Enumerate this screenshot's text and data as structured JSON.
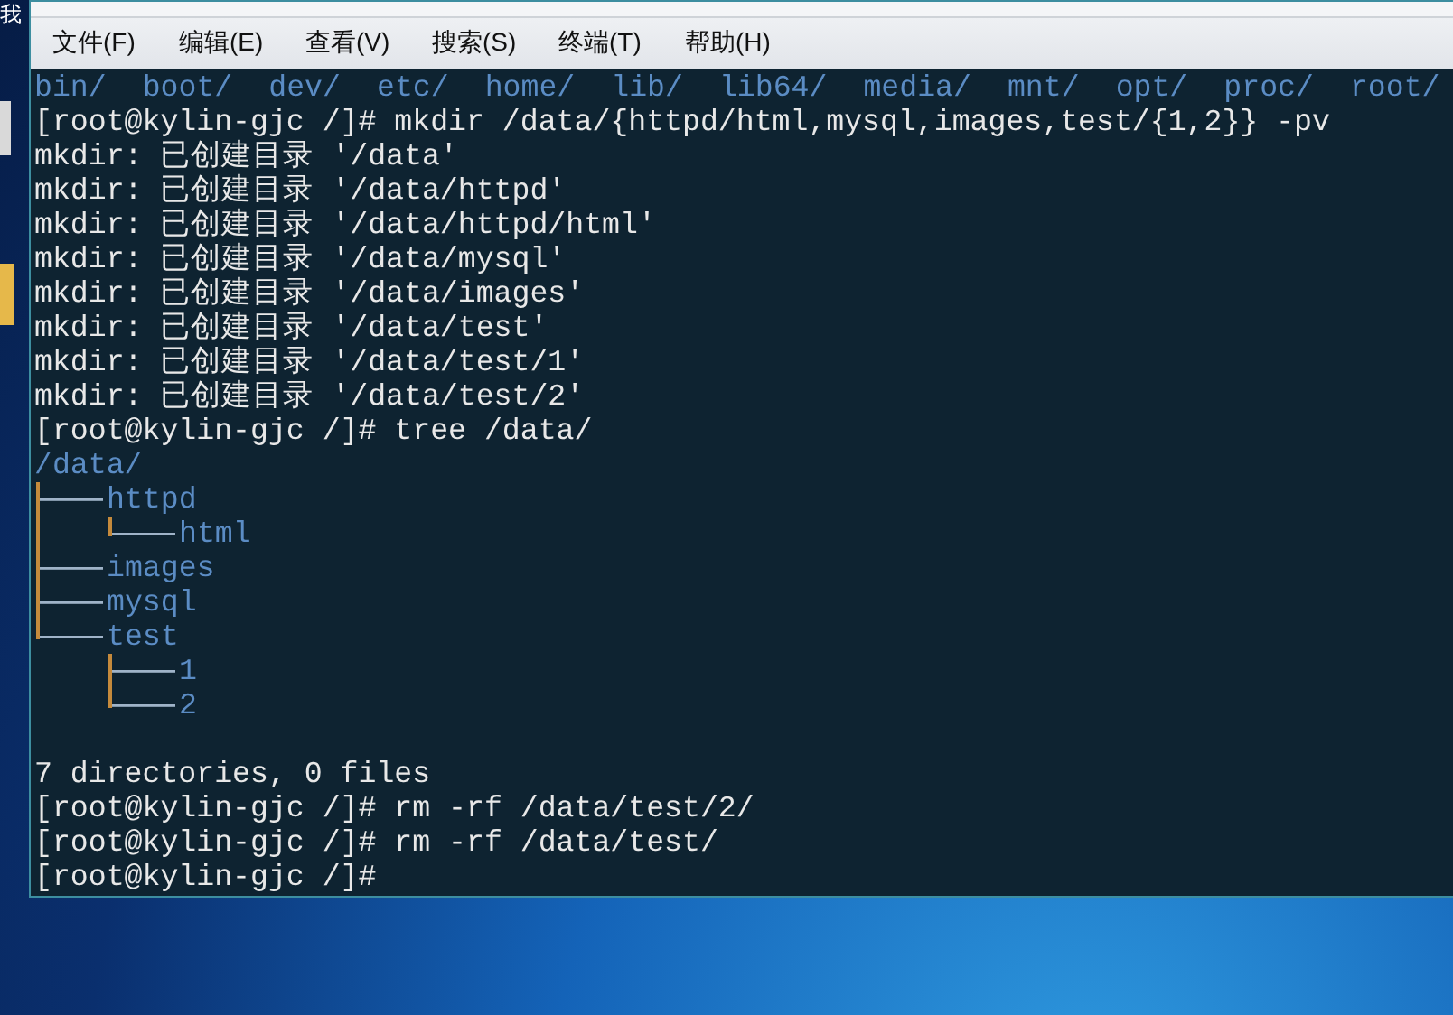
{
  "desktop": {
    "icon_labels": [
      "我"
    ]
  },
  "window": {
    "menu": [
      "文件(F)",
      "编辑(E)",
      "查看(V)",
      "搜索(S)",
      "终端(T)",
      "帮助(H)"
    ]
  },
  "terminal": {
    "blocks": [
      {
        "kind": "listing",
        "entries": [
          "bin/",
          "boot/",
          "dev/",
          "etc/",
          "home/",
          "lib/",
          "lib64/",
          "media/",
          "mnt/",
          "opt/",
          "proc/",
          "root/"
        ]
      },
      {
        "kind": "text",
        "text": "[root@kylin-gjc /]# mkdir /data/{httpd/html,mysql,images,test/{1,2}} -pv"
      },
      {
        "kind": "text",
        "text": "mkdir: 已创建目录 '/data'"
      },
      {
        "kind": "text",
        "text": "mkdir: 已创建目录 '/data/httpd'"
      },
      {
        "kind": "text",
        "text": "mkdir: 已创建目录 '/data/httpd/html'"
      },
      {
        "kind": "text",
        "text": "mkdir: 已创建目录 '/data/mysql'"
      },
      {
        "kind": "text",
        "text": "mkdir: 已创建目录 '/data/images'"
      },
      {
        "kind": "text",
        "text": "mkdir: 已创建目录 '/data/test'"
      },
      {
        "kind": "text",
        "text": "mkdir: 已创建目录 '/data/test/1'"
      },
      {
        "kind": "text",
        "text": "mkdir: 已创建目录 '/data/test/2'"
      },
      {
        "kind": "text",
        "text": "[root@kylin-gjc /]# tree /data/"
      },
      {
        "kind": "tree",
        "root": "/data/",
        "children": [
          {
            "name": "httpd",
            "children": [
              {
                "name": "html"
              }
            ]
          },
          {
            "name": "images"
          },
          {
            "name": "mysql"
          },
          {
            "name": "test",
            "children": [
              {
                "name": "1"
              },
              {
                "name": "2"
              }
            ]
          }
        ]
      },
      {
        "kind": "blank"
      },
      {
        "kind": "text",
        "text": "7 directories, 0 files"
      },
      {
        "kind": "text",
        "text": "[root@kylin-gjc /]# rm -rf /data/test/2/"
      },
      {
        "kind": "text",
        "text": "[root@kylin-gjc /]# rm -rf /data/test/"
      },
      {
        "kind": "text",
        "text": "[root@kylin-gjc /]#"
      }
    ]
  }
}
